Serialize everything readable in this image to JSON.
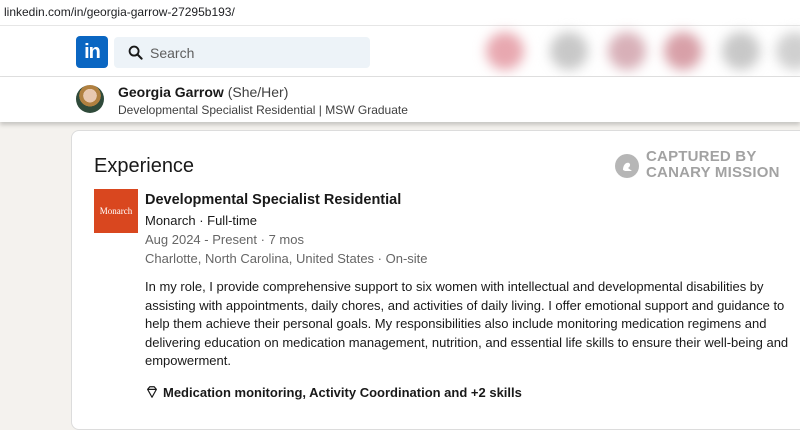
{
  "browser": {
    "url": "linkedin.com/in/georgia-garrow-27295b193/"
  },
  "nav": {
    "logo_text": "in",
    "search_placeholder": "Search"
  },
  "profile": {
    "name": "Georgia Garrow",
    "pronouns": "(She/Her)",
    "headline": "Developmental Specialist Residential | MSW Graduate"
  },
  "experience": {
    "section_title": "Experience",
    "watermark_line1": "CAPTURED BY",
    "watermark_line2": "CANARY MISSION",
    "company_logo_text": "Monarch",
    "job_title": "Developmental Specialist Residential",
    "company_line": "Monarch · Full-time",
    "dates": "Aug 2024 - Present · 7 mos",
    "location": "Charlotte, North Carolina, United States · On-site",
    "description": "In my role, I provide comprehensive support to six women with intellectual and developmental disabilities by assisting with appointments, daily chores, and activities of daily living. I offer emotional support and guidance to help them achieve their personal goals. My responsibilities also include monitoring medication regimens and delivering education on medication management, nutrition, and essential life skills to ensure their well-being and empowerment.",
    "skills": "Medication monitoring, Activity Coordination and +2 skills"
  },
  "colors": {
    "brand": "#0a66c2",
    "company_logo_bg": "#d9471f",
    "page_bg": "#f4f2ee"
  },
  "icons": {
    "search": "search-icon",
    "skills": "diamond-icon",
    "watermark": "canary-icon"
  }
}
